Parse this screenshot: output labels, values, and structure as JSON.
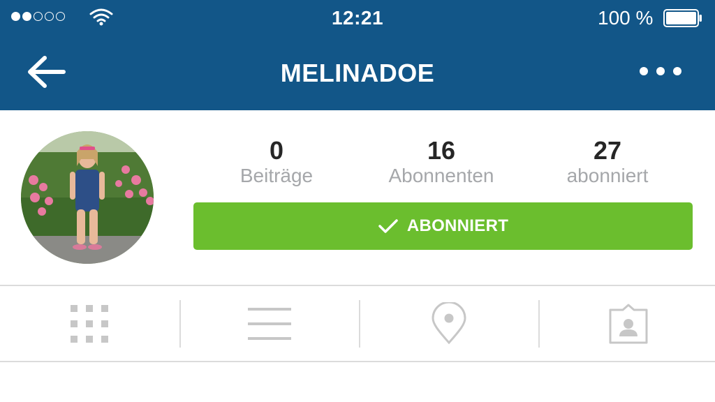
{
  "status_bar": {
    "time": "12:21",
    "battery_percent": "100 %",
    "signal_bars_filled": 2,
    "signal_bars_total": 5
  },
  "nav": {
    "title": "MELINADOE",
    "back_icon": "arrow-left-icon",
    "more_icon": "more-dots-icon"
  },
  "profile": {
    "stats": [
      {
        "value": "0",
        "label": "Beiträge"
      },
      {
        "value": "16",
        "label": "Abonnenten"
      },
      {
        "value": "27",
        "label": "abonniert"
      }
    ],
    "follow_button": {
      "label": "ABONNIERT",
      "icon": "checkmark-icon"
    }
  },
  "tabs": [
    {
      "name": "grid-view",
      "icon": "grid-icon"
    },
    {
      "name": "list-view",
      "icon": "list-icon"
    },
    {
      "name": "map-view",
      "icon": "location-pin-icon"
    },
    {
      "name": "tagged-view",
      "icon": "person-tag-icon"
    }
  ],
  "colors": {
    "header_bg": "#125688",
    "follow_button_bg": "#6bbe2e",
    "stat_value": "#262626",
    "stat_label": "#a5a7aa",
    "tab_icon": "#c7c7c7"
  }
}
